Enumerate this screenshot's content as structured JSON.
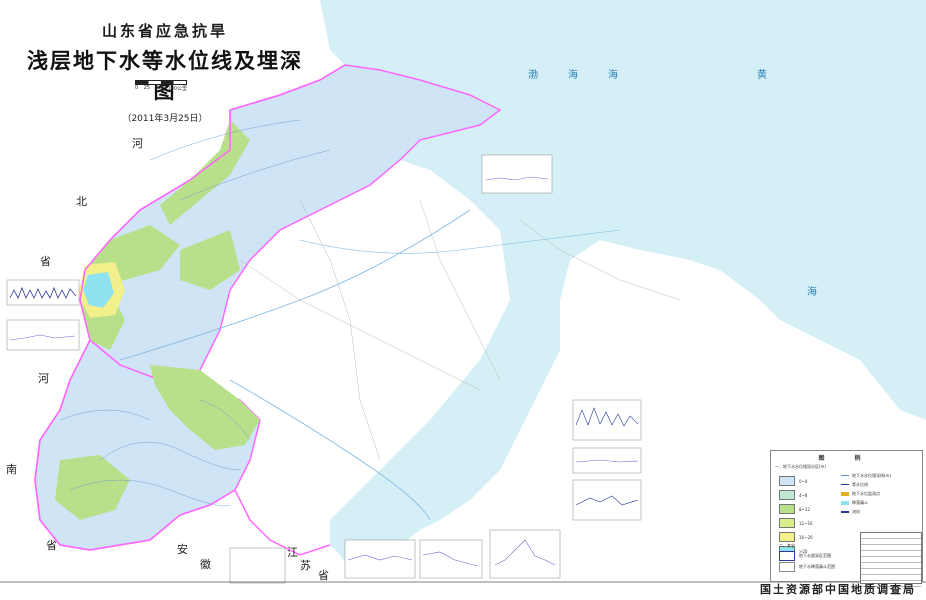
{
  "title": {
    "main": "山东省应急抗旱",
    "sub": "浅层地下水等水位线及埋深图",
    "date": "（2011年3月25日）"
  },
  "scale": {
    "labels": [
      "0",
      "25",
      "50",
      "100公里"
    ]
  },
  "regions": {
    "hebei_1": "河",
    "hebei_2": "北",
    "hebei_3": "省",
    "henan_1": "河",
    "henan_2": "南",
    "henan_3": "省",
    "anhui_1": "安",
    "anhui_2": "徽",
    "jiangsu_1": "江",
    "jiangsu_2": "苏",
    "jiangsu_3": "省"
  },
  "seas": {
    "bohai": "渤海海",
    "yellow_1": "黄",
    "yellow_2": "海"
  },
  "legend": {
    "title": "图 例",
    "section1": "一、地下水水位埋深分区(m)",
    "depth_classes": [
      "0~4",
      "4~8",
      "8~12",
      "12~16",
      "16~20",
      ">20"
    ],
    "symbols": [
      "地下水水位埋深线(m)",
      "等水位线",
      "地下水位监测点",
      "降落漏斗",
      "流向"
    ],
    "section2": "二、其它",
    "others": [
      "地下水超采区范围",
      "地下水降落漏斗范围"
    ]
  },
  "colors": {
    "sea": "#d4f0f6",
    "blue_zone": "#cfe4f5",
    "green_zone": "#b8e08a",
    "yellow_zone": "#f2f08a",
    "cyan_zone": "#8fe2ef",
    "boundary": "#ff66ff",
    "land_other": "#ffffff"
  },
  "footer": {
    "org": "国土资源部中国地质调查局"
  }
}
